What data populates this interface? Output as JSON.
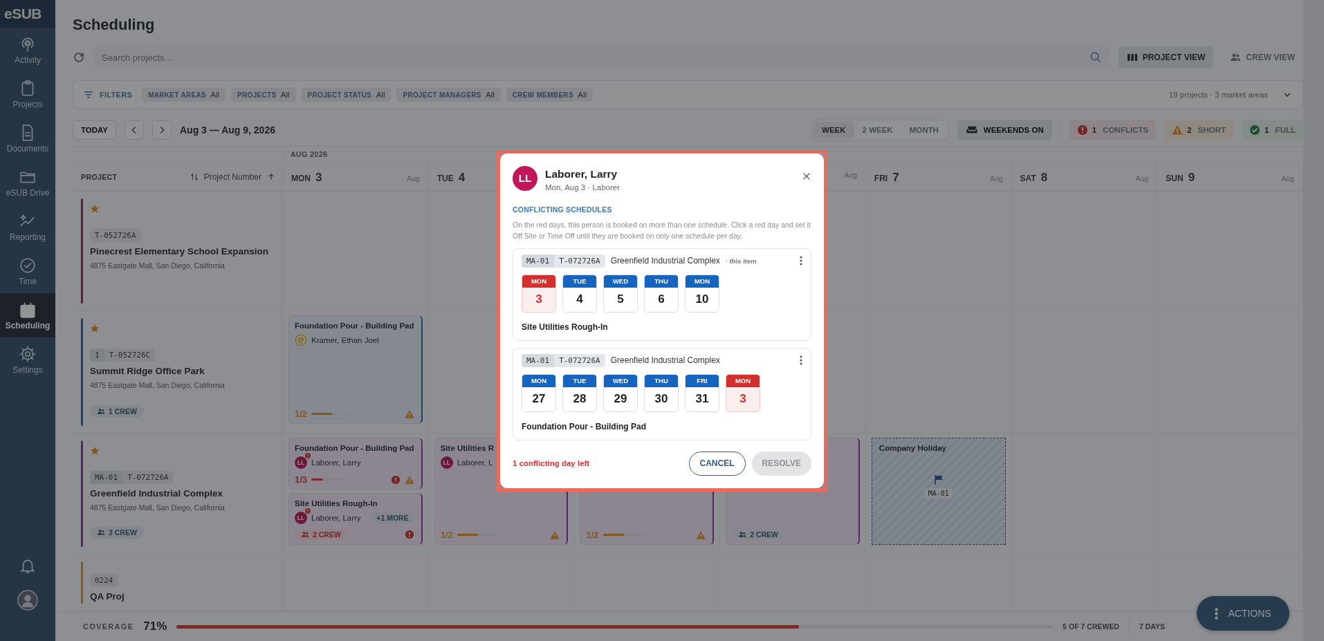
{
  "sidebar": {
    "logo": "eSUB",
    "items": [
      {
        "label": "Activity",
        "selected": false
      },
      {
        "label": "Projects",
        "selected": false
      },
      {
        "label": "Documents",
        "selected": false
      },
      {
        "label": "eSUB Drive",
        "selected": false
      },
      {
        "label": "Reporting",
        "selected": false
      },
      {
        "label": "Time",
        "selected": false
      },
      {
        "label": "Scheduling",
        "selected": true
      },
      {
        "label": "Settings",
        "selected": false
      }
    ]
  },
  "page": {
    "title": "Scheduling"
  },
  "search": {
    "placeholder": "Search projects..."
  },
  "views": [
    {
      "label": "PROJECT VIEW",
      "selected": true
    },
    {
      "label": "CREW VIEW",
      "selected": false
    }
  ],
  "filters": {
    "label": "FILTERS",
    "chips": [
      {
        "label": "MARKET AREAS",
        "value": "All"
      },
      {
        "label": "PROJECTS",
        "value": "All"
      },
      {
        "label": "PROJECT STATUS",
        "value": "All"
      },
      {
        "label": "PROJECT MANAGERS",
        "value": "All"
      },
      {
        "label": "CREW MEMBERS",
        "value": "All"
      }
    ],
    "summary": "19 projects · 3 market areas"
  },
  "toolbar": {
    "today": "TODAY",
    "range_label": "Aug 3 — Aug 9, 2026",
    "ranges": [
      {
        "label": "WEEK",
        "selected": true
      },
      {
        "label": "2 WEEK",
        "selected": false
      },
      {
        "label": "MONTH",
        "selected": false
      }
    ],
    "weekends": "WEEKENDS ON",
    "status_chips": [
      {
        "kind": "conflict",
        "count": "1",
        "label": "CONFLICTS"
      },
      {
        "kind": "short",
        "count": "2",
        "label": "SHORT"
      },
      {
        "kind": "full",
        "count": "1",
        "label": "FULL"
      }
    ]
  },
  "calendar": {
    "month": "AUG 2026",
    "project_header": "PROJECT",
    "sort_label": "Project Number",
    "days": [
      {
        "name": "MON",
        "num": "3",
        "month": "Aug"
      },
      {
        "name": "TUE",
        "num": "4"
      },
      {
        "month": "Aug"
      },
      {
        "name": "FRI",
        "num": "7",
        "month": "Aug"
      },
      {
        "name": "SAT",
        "num": "8",
        "month": "Aug"
      },
      {
        "name": "SUN",
        "num": "9",
        "month": "Aug"
      }
    ],
    "rows": [
      {
        "starred": true,
        "tags": [
          "T-052726A"
        ],
        "name": "Pinecrest Elementary School Expansion",
        "address": "4875 Eastgate Mall, San Diego, California",
        "color": "#631b38"
      },
      {
        "starred": true,
        "tags": [
          "1",
          "T-052726C"
        ],
        "name": "Summit Ridge Office Park",
        "address": "4875 Eastgate Mall, San Diego, California",
        "color": "#1f416d",
        "crew": "1 CREW",
        "cells": [
          [
            {
              "kind": "task",
              "title": "Foundation Pour - Building Pad",
              "assignee": {
                "name": "Kramer, Ethan Joel"
              },
              "ratio": "1/2",
              "level": 0.5,
              "conflict": false,
              "warning": true
            }
          ]
        ]
      },
      {
        "starred": true,
        "tags": [
          "MA-01",
          "T-072726A"
        ],
        "name": "Greenfield Industrial Complex",
        "address": "4875 Eastgate Mall, San Diego, California",
        "color": "#582566",
        "crew": "3 CREW",
        "cells": [
          [
            {
              "kind": "task",
              "title": "Foundation Pour - Building Pad",
              "assignee": {
                "name": "Laborer, Larry",
                "initials": "LL",
                "conflict": true
              },
              "ratio": "1/3",
              "level": 0.33,
              "conflict": true,
              "alert": true,
              "warning": true
            },
            {
              "kind": "task",
              "title": "Site Utilities Rough-In",
              "assignee": {
                "name": "Laborer, Larry",
                "initials": "LL",
                "conflict": true
              },
              "more": "+1 MORE",
              "crew": "2 CREW",
              "crew_alert": true,
              "alert": true
            }
          ],
          [
            {
              "kind": "task",
              "title": "Site Utilities R",
              "assignee": {
                "name": "Laborer, L",
                "initials": "LL",
                "conflict": false
              },
              "ratio": "1/2",
              "level": 0.5,
              "conflict": false,
              "warning": true
            }
          ],
          [
            {
              "kind": "task",
              "ratio": "1/2",
              "level": 0.5,
              "conflict": false,
              "warning": true
            }
          ],
          [
            {
              "kind": "task",
              "crew": "2 CREW",
              "crew_alert": false
            }
          ],
          [
            {
              "kind": "holiday",
              "title": "Company Holiday",
              "tag": "MA-01"
            }
          ]
        ]
      },
      {
        "starred": false,
        "tags": [
          "0224"
        ],
        "name": "QA Proj",
        "color": "#83571f"
      }
    ]
  },
  "coverage": {
    "label": "COVERAGE",
    "value": "71%",
    "level": 0.71,
    "crewed": "5 OF 7 CREWED",
    "days": "7 DAYS"
  },
  "actions": "ACTIONS",
  "dialog": {
    "initials": "LL",
    "name": "Laborer, Larry",
    "subtitle": "Mon, Aug 3 · Laborer",
    "heading": "CONFLICTING SCHEDULES",
    "description": "On the red days, this person is booked on more than one schedule. Click a red day and set it Off Site or Time Off until they are booked on only one schedule per day.",
    "schedules": [
      {
        "tags": [
          "MA-01",
          "T-072726A"
        ],
        "project": "Greenfield Industrial Complex",
        "note": "· this item",
        "task": "Site Utilities Rough-In",
        "days": [
          {
            "dow": "MON",
            "num": "3",
            "conflict": true
          },
          {
            "dow": "TUE",
            "num": "4",
            "conflict": false
          },
          {
            "dow": "WED",
            "num": "5",
            "conflict": false
          },
          {
            "dow": "THU",
            "num": "6",
            "conflict": false
          },
          {
            "dow": "MON",
            "num": "10",
            "conflict": false
          }
        ]
      },
      {
        "tags": [
          "MA-01",
          "T-072726A"
        ],
        "project": "Greenfield Industrial Complex",
        "task": "Foundation Pour - Building Pad",
        "days": [
          {
            "dow": "MON",
            "num": "27",
            "conflict": false
          },
          {
            "dow": "TUE",
            "num": "28",
            "conflict": false
          },
          {
            "dow": "WED",
            "num": "29",
            "conflict": false
          },
          {
            "dow": "THU",
            "num": "30",
            "conflict": false
          },
          {
            "dow": "FRI",
            "num": "31",
            "conflict": false
          },
          {
            "dow": "MON",
            "num": "3",
            "conflict": true
          }
        ]
      }
    ],
    "remaining": "1 conflicting day left",
    "cancel": "CANCEL",
    "resolve": {
      "label": "RESOLVE",
      "disabled": true
    }
  }
}
